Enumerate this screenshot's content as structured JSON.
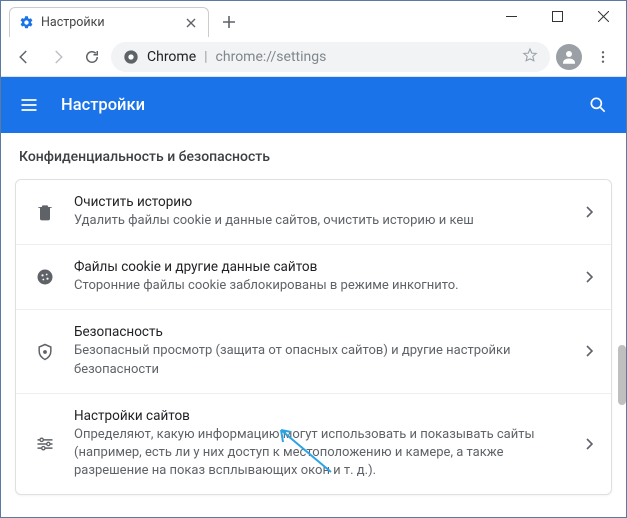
{
  "tab": {
    "title": "Настройки"
  },
  "omnibox": {
    "host": "Chrome",
    "path": "chrome://settings"
  },
  "header": {
    "title": "Настройки"
  },
  "section": {
    "title": "Конфиденциальность и безопасность"
  },
  "rows": [
    {
      "title": "Очистить историю",
      "sub": "Удалить файлы cookie и данные сайтов, очистить историю и кеш"
    },
    {
      "title": "Файлы cookie и другие данные сайтов",
      "sub": "Сторонние файлы cookie заблокированы в режиме инкогнито."
    },
    {
      "title": "Безопасность",
      "sub": "Безопасный просмотр (защита от опасных сайтов) и другие настройки безопасности"
    },
    {
      "title": "Настройки сайтов",
      "sub": "Определяют, какую информацию могут использовать и показывать сайты (например, есть ли у них доступ к местоположению и камере, а также разрешение на показ всплывающих окон и т. д.)."
    }
  ]
}
